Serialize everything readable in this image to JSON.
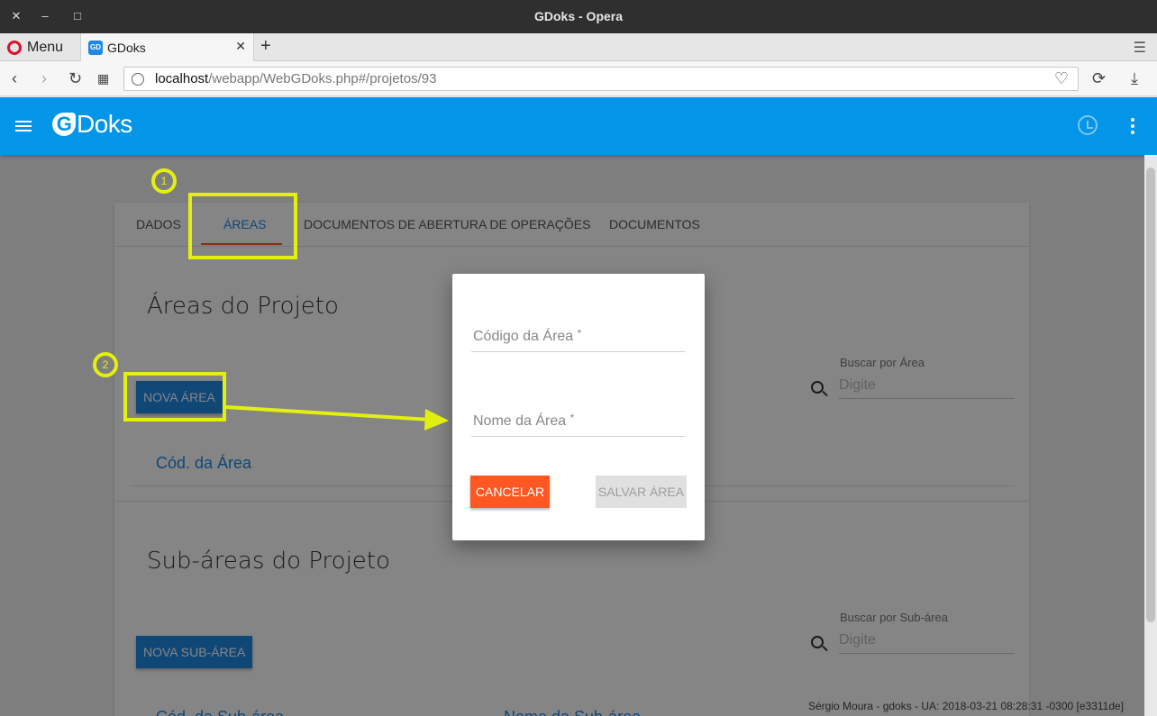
{
  "window": {
    "title": "GDoks - Opera"
  },
  "browser": {
    "menu_label": "Menu",
    "tab_title": "GDoks",
    "favicon_text": "GD",
    "new_tab": "+",
    "url_host": "localhost",
    "url_path": "/webapp/WebGDoks.php#/projetos/93"
  },
  "app": {
    "logo_letter": "G",
    "logo_text": "Doks",
    "accent": "#0395e8"
  },
  "tabs": [
    {
      "label": "DADOS"
    },
    {
      "label": "ÁREAS",
      "active": true
    },
    {
      "label": "DOCUMENTOS DE ABERTURA DE OPERAÇÕES"
    },
    {
      "label": "DOCUMENTOS"
    }
  ],
  "areas": {
    "title": "Áreas do Projeto",
    "new_button": "NOVA ÁREA",
    "search_label": "Buscar por Área",
    "search_placeholder": "Digite",
    "col_code": "Cód. da Área"
  },
  "subareas": {
    "title": "Sub-áreas do Projeto",
    "new_button": "NOVA SUB-ÁREA",
    "search_label": "Buscar por Sub-área",
    "search_placeholder": "Digite",
    "col_code": "Cód. da Sub-área",
    "col_name": "Nome da Sub-área"
  },
  "modal": {
    "code_label": "Código da Área",
    "name_label": "Nome da Área",
    "required_mark": "*",
    "cancel": "CANCELAR",
    "save": "SALVAR ÁREA"
  },
  "annotations": {
    "step1": "1",
    "step2": "2"
  },
  "footer": "Sérgio Moura - gdoks - UA: 2018-03-21 08:28:31 -0300 [e3311de]"
}
